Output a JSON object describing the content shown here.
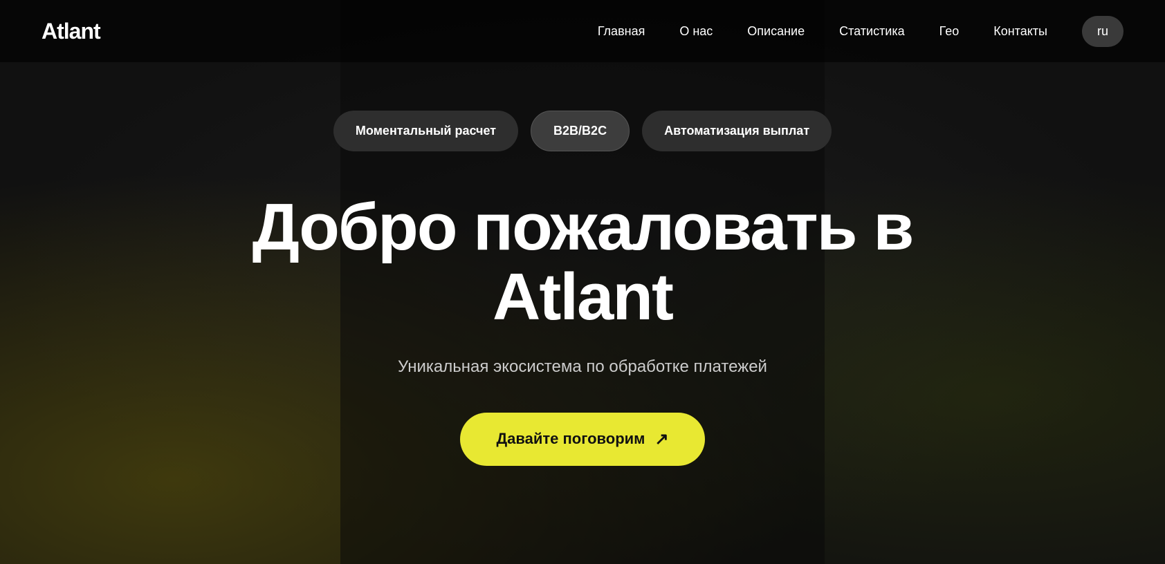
{
  "logo": {
    "text": "Atlant"
  },
  "nav": {
    "links": [
      {
        "label": "Главная",
        "id": "nav-home"
      },
      {
        "label": "О нас",
        "id": "nav-about"
      },
      {
        "label": "Описание",
        "id": "nav-description"
      },
      {
        "label": "Статистика",
        "id": "nav-stats"
      },
      {
        "label": "Гео",
        "id": "nav-geo"
      },
      {
        "label": "Контакты",
        "id": "nav-contacts"
      }
    ],
    "lang_button": "ru"
  },
  "badges": [
    {
      "label": "Моментальный расчет",
      "active": false
    },
    {
      "label": "B2B/B2C",
      "active": true
    },
    {
      "label": "Автоматизация выплат",
      "active": false
    }
  ],
  "hero": {
    "headline_line1": "Добро пожаловать в",
    "headline_line2": "Atlant",
    "subtitle": "Уникальная экосистема по обработке платежей",
    "cta_label": "Давайте поговорим",
    "cta_arrow": "↗"
  }
}
